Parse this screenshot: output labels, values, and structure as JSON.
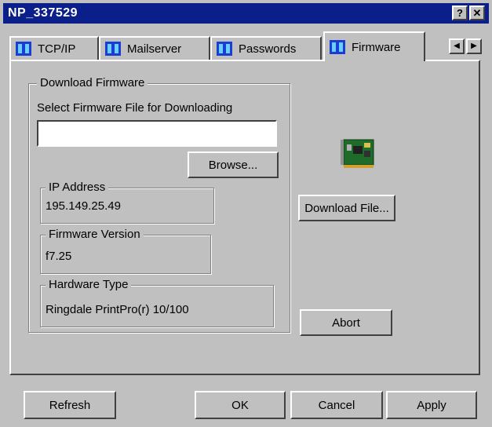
{
  "window": {
    "title": "NP_337529",
    "help_label": "?",
    "close_label": "✕"
  },
  "tabs": [
    {
      "label": "TCP/IP"
    },
    {
      "label": "Mailserver"
    },
    {
      "label": "Passwords"
    },
    {
      "label": "Firmware"
    }
  ],
  "tab_scroll": {
    "left_label": "◀",
    "right_label": "▶"
  },
  "firmware": {
    "group_label": "Download Firmware",
    "select_label": "Select Firmware File for Downloading",
    "file_value": "",
    "browse_label": "Browse...",
    "ip": {
      "label": "IP Address",
      "value": "195.149.25.49"
    },
    "version": {
      "label": "Firmware Version",
      "value": "f7.25"
    },
    "hardware": {
      "label": "Hardware Type",
      "value": "Ringdale PrintPro(r) 10/100"
    },
    "download_label": "Download File...",
    "abort_label": "Abort"
  },
  "buttons": {
    "refresh": "Refresh",
    "ok": "OK",
    "cancel": "Cancel",
    "apply": "Apply"
  }
}
